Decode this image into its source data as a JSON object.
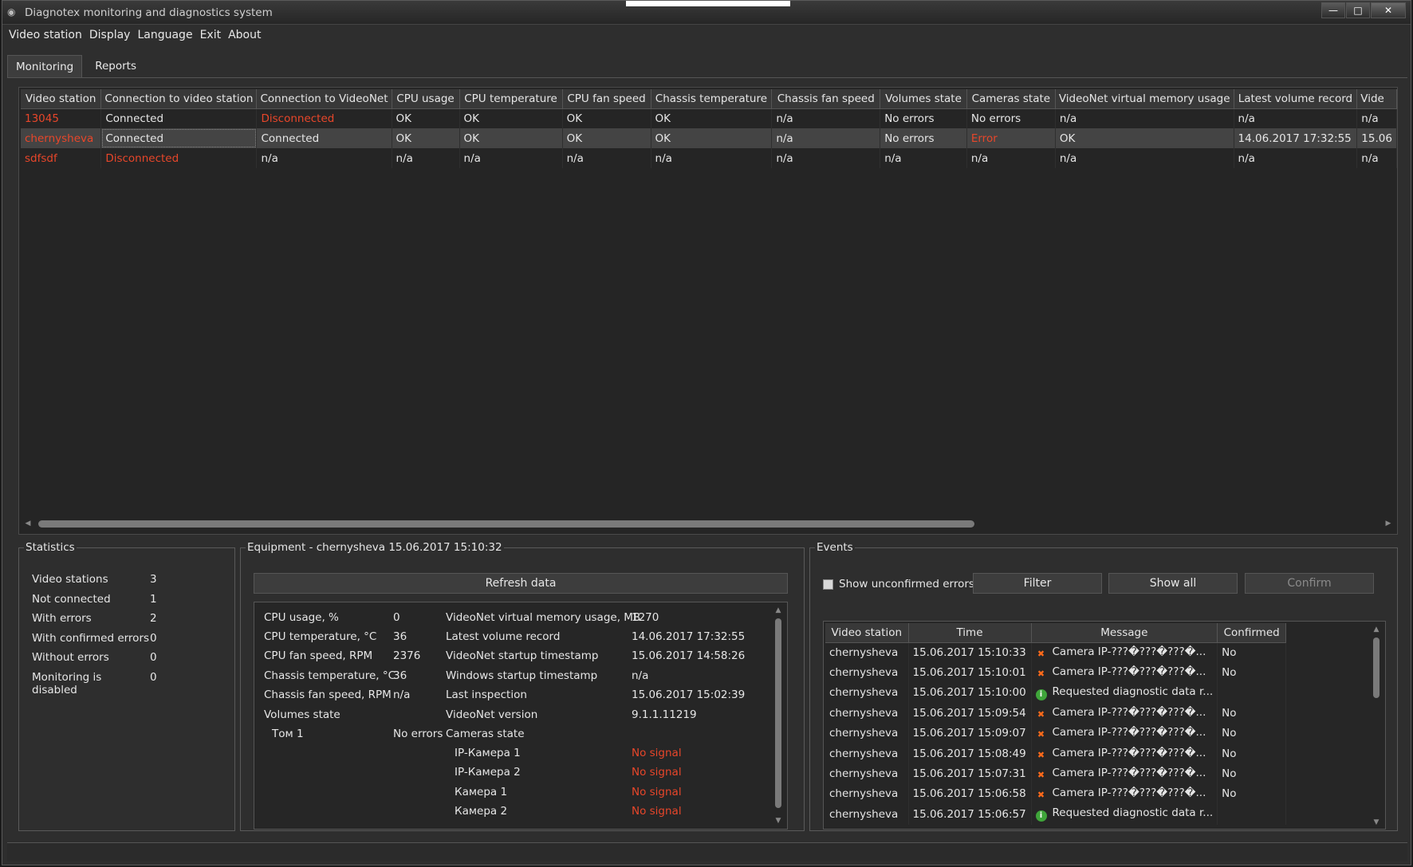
{
  "window": {
    "title": "Diagnotex monitoring and diagnostics system"
  },
  "menu": [
    "Video station",
    "Display",
    "Language",
    "Exit",
    "About"
  ],
  "tabs": [
    "Monitoring",
    "Reports"
  ],
  "main_table": {
    "columns": [
      "Video station",
      "Connection to video station",
      "Connection to VideoNet",
      "CPU usage",
      "CPU temperature",
      "CPU fan speed",
      "Chassis temperature",
      "Chassis fan speed",
      "Volumes state",
      "Cameras state",
      "VideoNet virtual memory usage",
      "Latest volume record",
      "Vide"
    ],
    "rows": [
      [
        "13045",
        "Connected",
        "Disconnected",
        "OK",
        "OK",
        "OK",
        "OK",
        "n/a",
        "No errors",
        "No errors",
        "n/a",
        "n/a",
        "n/a"
      ],
      [
        "chernysheva",
        "Connected",
        "Connected",
        "OK",
        "OK",
        "OK",
        "OK",
        "n/a",
        "No errors",
        "Error",
        "OK",
        "14.06.2017 17:32:55",
        "15.06"
      ],
      [
        "sdfsdf",
        "Disconnected",
        "n/a",
        "n/a",
        "n/a",
        "n/a",
        "n/a",
        "n/a",
        "n/a",
        "n/a",
        "n/a",
        "n/a",
        "n/a"
      ]
    ]
  },
  "statistics": {
    "title": "Statistics",
    "items": [
      {
        "label": "Video stations",
        "value": "3"
      },
      {
        "label": "Not connected",
        "value": "1"
      },
      {
        "label": "With errors",
        "value": "2"
      },
      {
        "label": "With confirmed errors",
        "value": "0"
      },
      {
        "label": "Without errors",
        "value": "0"
      },
      {
        "label": "Monitoring is disabled",
        "value": "0"
      }
    ]
  },
  "equipment": {
    "title": "Equipment - chernysheva 15.06.2017 15:10:32",
    "refresh_label": "Refresh data",
    "left": [
      {
        "label": "CPU usage, %",
        "value": "0"
      },
      {
        "label": "CPU temperature, °C",
        "value": "36"
      },
      {
        "label": "CPU fan speed, RPM",
        "value": "2376"
      },
      {
        "label": "Chassis temperature, °C",
        "value": "36"
      },
      {
        "label": "Chassis fan speed, RPM",
        "value": "n/a"
      },
      {
        "label": "Volumes state",
        "value": ""
      }
    ],
    "volume": {
      "name": "Том 1",
      "value": "No errors"
    },
    "right": [
      {
        "label": "VideoNet virtual memory usage, MB",
        "value": "1270"
      },
      {
        "label": "Latest volume record",
        "value": "14.06.2017 17:32:55"
      },
      {
        "label": "VideoNet startup timestamp",
        "value": "15.06.2017 14:58:26"
      },
      {
        "label": "Windows startup timestamp",
        "value": "n/a"
      },
      {
        "label": "Last inspection",
        "value": "15.06.2017 15:02:39"
      },
      {
        "label": "VideoNet version",
        "value": "9.1.1.11219"
      },
      {
        "label": "Cameras state",
        "value": ""
      }
    ],
    "cameras": [
      {
        "name": "IP-Камера 1",
        "state": "No signal"
      },
      {
        "name": "IP-Камера 2",
        "state": "No signal"
      },
      {
        "name": "Камера 1",
        "state": "No signal"
      },
      {
        "name": "Камера 2",
        "state": "No signal"
      }
    ]
  },
  "events": {
    "title": "Events",
    "show_unconfirmed_label": "Show unconfirmed errors",
    "filter_label": "Filter",
    "show_all_label": "Show all",
    "confirm_label": "Confirm",
    "columns": [
      "Video station",
      "Time",
      "Message",
      "Confirmed"
    ],
    "rows": [
      {
        "station": "chernysheva",
        "time": "15.06.2017 15:10:33",
        "icon": "error-icon",
        "message": "Camera IP-???�???�???�...",
        "confirmed": "No"
      },
      {
        "station": "chernysheva",
        "time": "15.06.2017 15:10:01",
        "icon": "error-icon",
        "message": "Camera IP-???�???�???�...",
        "confirmed": "No"
      },
      {
        "station": "chernysheva",
        "time": "15.06.2017 15:10:00",
        "icon": "info-icon",
        "message": "Requested diagnostic data r...",
        "confirmed": ""
      },
      {
        "station": "chernysheva",
        "time": "15.06.2017 15:09:54",
        "icon": "error-icon",
        "message": "Camera IP-???�???�???�...",
        "confirmed": "No"
      },
      {
        "station": "chernysheva",
        "time": "15.06.2017 15:09:07",
        "icon": "error-icon",
        "message": "Camera IP-???�???�???�...",
        "confirmed": "No"
      },
      {
        "station": "chernysheva",
        "time": "15.06.2017 15:08:49",
        "icon": "error-icon",
        "message": "Camera IP-???�???�???�...",
        "confirmed": "No"
      },
      {
        "station": "chernysheva",
        "time": "15.06.2017 15:07:31",
        "icon": "error-icon",
        "message": "Camera IP-???�???�???�...",
        "confirmed": "No"
      },
      {
        "station": "chernysheva",
        "time": "15.06.2017 15:06:58",
        "icon": "error-icon",
        "message": "Camera IP-???�???�???�...",
        "confirmed": "No"
      },
      {
        "station": "chernysheva",
        "time": "15.06.2017 15:06:57",
        "icon": "info-icon",
        "message": "Requested diagnostic data r...",
        "confirmed": ""
      }
    ]
  },
  "colors": {
    "error": "#e8462a",
    "background": "#2e2e2e",
    "header": "#383838"
  }
}
